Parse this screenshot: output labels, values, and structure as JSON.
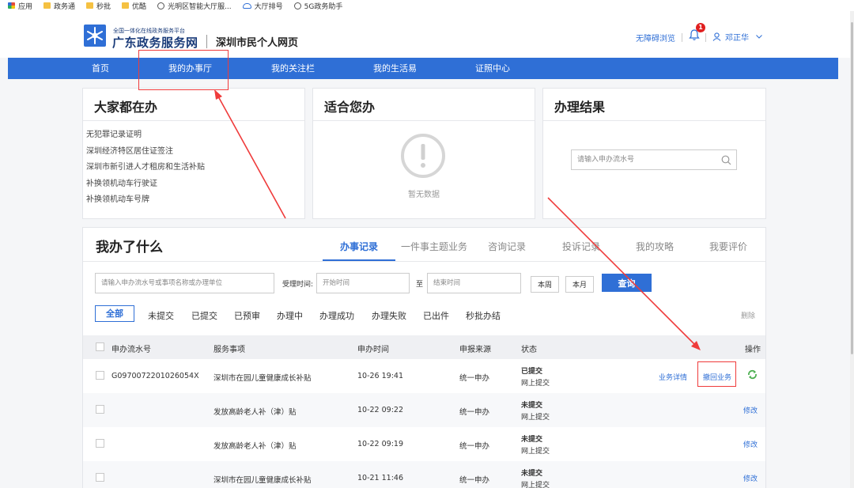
{
  "bookmarks": [
    {
      "icon": "apps-icon",
      "label": "应用"
    },
    {
      "icon": "folder-icon",
      "label": "政务通"
    },
    {
      "icon": "folder-icon",
      "label": "秒批"
    },
    {
      "icon": "folder-icon",
      "label": "优酷"
    },
    {
      "icon": "globe-icon",
      "label": "光明区智能大厅服..."
    },
    {
      "icon": "cloud-icon",
      "label": "大厅排号"
    },
    {
      "icon": "globe-icon",
      "label": "5G政务助手"
    }
  ],
  "header": {
    "logo_small": "全国一体化在线政务服务平台",
    "logo_main": "广东政务服务网",
    "subtitle": "深圳市民个人网页",
    "accessibility": "无障碍浏览",
    "notification_count": "1",
    "user_name": "邓正华"
  },
  "nav": [
    "首页",
    "我的办事厅",
    "我的关注栏",
    "我的生活易",
    "证照中心"
  ],
  "popular": {
    "title": "大家都在办",
    "items": [
      "无犯罪记录证明",
      "深圳经济特区居住证签注",
      "深圳市新引进人才租房和生活补贴",
      "补换领机动车行驶证",
      "补换领机动车号牌"
    ]
  },
  "suitable": {
    "title": "适合您办",
    "empty": "暂无数据"
  },
  "result": {
    "title": "办理结果",
    "placeholder": "请输入申办流水号"
  },
  "main": {
    "title": "我办了什么",
    "tabs": [
      "办事记录",
      "一件事主题业务",
      "咨询记录",
      "投诉记录",
      "我的攻略",
      "我要评价"
    ],
    "search_placeholder": "请输入申办流水号或事项名称或办理单位",
    "time_label": "受理时间:",
    "start_placeholder": "开始时间",
    "to_label": "至",
    "end_placeholder": "结束时间",
    "this_week": "本周",
    "this_month": "本月",
    "query": "查询",
    "filters": [
      "全部",
      "未提交",
      "已提交",
      "已预审",
      "办理中",
      "办理成功",
      "办理失败",
      "已出件",
      "秒批办结"
    ],
    "delete": "删除",
    "columns": [
      "申办流水号",
      "服务事项",
      "申办时间",
      "申报来源",
      "状态",
      "操作"
    ],
    "rows": [
      {
        "id": "G0970072201026054X",
        "service": "深圳市在园儿童健康成长补贴",
        "time": "10-26 19:41",
        "source": "统一申办",
        "status": "已提交",
        "sub": "网上提交",
        "detail": "业务详情",
        "action": "撤回业务"
      },
      {
        "id": "",
        "service": "发放高龄老人补（津）贴",
        "time": "10-22 09:22",
        "source": "统一申办",
        "status": "未提交",
        "sub": "网上提交",
        "action": "修改"
      },
      {
        "id": "",
        "service": "发放高龄老人补（津）贴",
        "time": "10-22 09:19",
        "source": "统一申办",
        "status": "未提交",
        "sub": "网上提交",
        "action": "修改"
      },
      {
        "id": "",
        "service": "深圳市在园儿童健康成长补贴",
        "time": "10-21 11:46",
        "source": "统一申办",
        "status": "未提交",
        "sub": "网上提交",
        "action": "修改"
      }
    ]
  },
  "colors": {
    "primary": "#2f6fd6",
    "annotation": "#ef3b3b",
    "badge": "#e02020",
    "refresh": "#4caf50"
  }
}
